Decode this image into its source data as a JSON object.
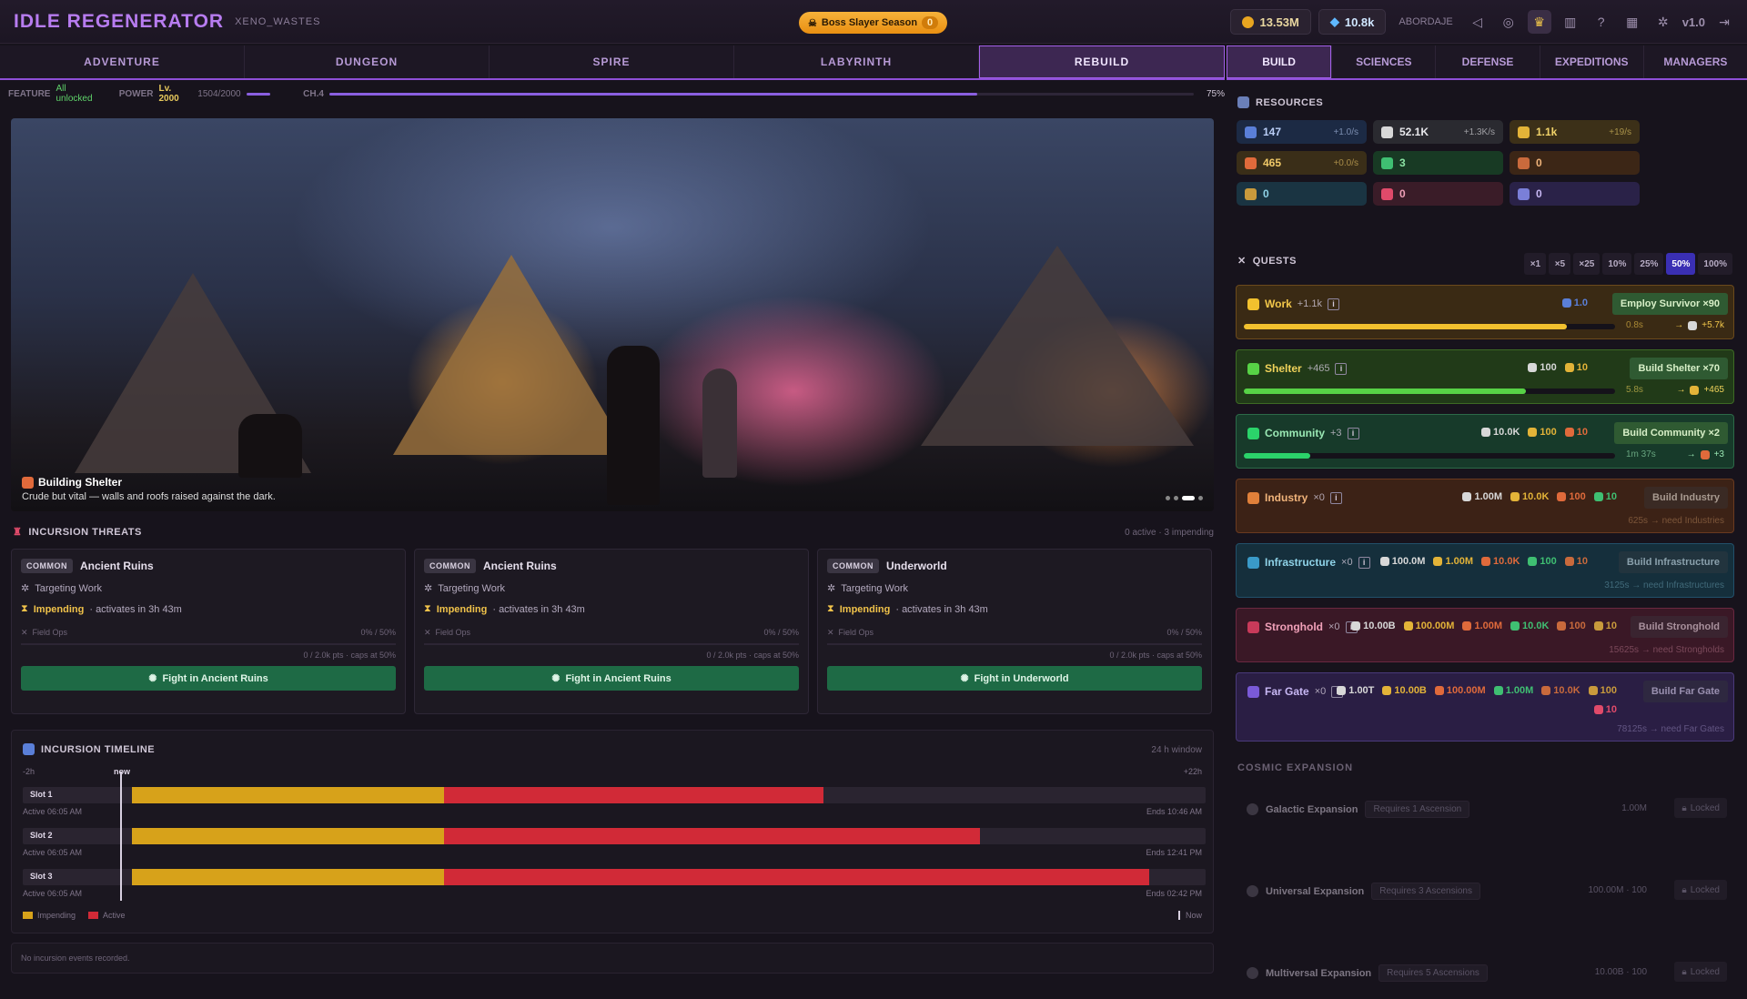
{
  "app": {
    "title": "IDLE REGENERATOR",
    "realm": "XENO_WASTES",
    "version": "v1.0"
  },
  "season": {
    "label": "Boss Slayer Season",
    "count": "0"
  },
  "currencies": {
    "gold": "13.53M",
    "gems": "10.8k",
    "player": "ABORDAJE"
  },
  "nav": {
    "tabs": [
      "ADVENTURE",
      "DUNGEON",
      "SPIRE",
      "LABYRINTH",
      "REBUILD"
    ],
    "active": 4
  },
  "subnav": {
    "tabs": [
      "BUILD",
      "SCIENCES",
      "DEFENSE",
      "EXPEDITIONS",
      "MANAGERS"
    ],
    "active": 0
  },
  "status": {
    "feature_label": "FEATURE",
    "feature_value": "All unlocked",
    "power_label": "POWER",
    "level": "Lv. 2000",
    "power_value": "1504/2000",
    "chapter": "CH.4",
    "chapter_pct": "75%",
    "chapter_progress": 0.75
  },
  "hero": {
    "title": "Building Shelter",
    "desc": "Crude but vital — walls and roofs raised against the dark."
  },
  "threats": {
    "title": "INCURSION THREATS",
    "summary": "0 active · 3 impending",
    "cards": [
      {
        "tag": "COMMON",
        "name": "Ancient Ruins",
        "target": "Targeting Work",
        "status": "Impending",
        "eta": "· activates in 3h 43m",
        "ops": "Field Ops",
        "ops_pct": "0% / 50%",
        "pts": "0 / 2.0k pts · caps at 50%",
        "button": "Fight in Ancient Ruins"
      },
      {
        "tag": "COMMON",
        "name": "Ancient Ruins",
        "target": "Targeting Work",
        "status": "Impending",
        "eta": "· activates in 3h 43m",
        "ops": "Field Ops",
        "ops_pct": "0% / 50%",
        "pts": "0 / 2.0k pts · caps at 50%",
        "button": "Fight in Ancient Ruins"
      },
      {
        "tag": "COMMON",
        "name": "Underworld",
        "target": "Targeting Work",
        "status": "Impending",
        "eta": "· activates in 3h 43m",
        "ops": "Field Ops",
        "ops_pct": "0% / 50%",
        "pts": "0 / 2.0k pts · caps at 50%",
        "button": "Fight in Underworld"
      }
    ]
  },
  "timeline": {
    "title": "INCURSION TIMELINE",
    "window": "24 h window",
    "start": "-2h",
    "now": "now",
    "end": "+22h",
    "slots": [
      {
        "label": "Slot 1",
        "active": "Active 06:05 AM",
        "ends": "Ends 10:46 AM",
        "imp_end": 7,
        "act_end": 15.5
      },
      {
        "label": "Slot 2",
        "active": "Active 06:05 AM",
        "ends": "Ends 12:41 PM",
        "imp_end": 7,
        "act_end": 19
      },
      {
        "label": "Slot 3",
        "active": "Active 06:05 AM",
        "ends": "Ends 02:42 PM",
        "imp_end": 7,
        "act_end": 22.8
      }
    ],
    "legend": {
      "impending": "Impending",
      "active": "Active",
      "now": "Now"
    },
    "empty": "No incursion events recorded."
  },
  "resources": {
    "title": "RESOURCES",
    "items": [
      {
        "value": "147",
        "rate": "+1.0/s",
        "color": "#5a7fd8",
        "bg": "#1c2a44",
        "fg": "#b9cdf6"
      },
      {
        "value": "52.1K",
        "rate": "+1.3K/s",
        "color": "#d8d8d8",
        "bg": "#2a2a30",
        "fg": "#e8e8ec"
      },
      {
        "value": "1.1k",
        "rate": "+19/s",
        "color": "#e3b338",
        "bg": "#3c3018",
        "fg": "#f1d36a"
      },
      {
        "value": "465",
        "rate": "+0.0/s",
        "color": "#e06a3b",
        "bg": "#3a2e18",
        "fg": "#f0c968"
      },
      {
        "value": "3",
        "rate": "",
        "color": "#3fbf72",
        "bg": "#183a24",
        "fg": "#8be3a4"
      },
      {
        "value": "0",
        "rate": "",
        "color": "#c96a3c",
        "bg": "#3c2616",
        "fg": "#f0b37a"
      },
      {
        "value": "0",
        "rate": "",
        "color": "#c99a3c",
        "bg": "#1a3442",
        "fg": "#8fd3e8"
      },
      {
        "value": "0",
        "rate": "",
        "color": "#e04a6a",
        "bg": "#3a1c28",
        "fg": "#f0a0b8"
      },
      {
        "value": "0",
        "rate": "",
        "color": "#7a7fd8",
        "bg": "#2a2248",
        "fg": "#c8b8f4"
      }
    ]
  },
  "quests": {
    "title": "QUESTS",
    "multipliers": [
      "×1",
      "×5",
      "×25",
      "10%",
      "25%",
      "50%",
      "100%"
    ],
    "active_mult": 5,
    "items": [
      {
        "name": "Work",
        "count": "+1.1k",
        "costs": [
          {
            "v": "1.0",
            "c": "#5a7fd8"
          }
        ],
        "button": "Employ Survivor ×90",
        "time": "0.8s",
        "out": "+5.7k",
        "out_c": "#d8d8d8",
        "progress": 0.87,
        "bar": "#f2c12e",
        "bg": "#3a2a14",
        "bd": "#6b4a1c",
        "fg": "#f2c74a",
        "btnbg": "#2f5a32",
        "btnfg": "#d8f0c8"
      },
      {
        "name": "Shelter",
        "count": "+465",
        "costs": [
          {
            "v": "100",
            "c": "#d8d8d8"
          },
          {
            "v": "10",
            "c": "#e3b338"
          }
        ],
        "button": "Build Shelter ×70",
        "time": "5.8s",
        "out": "+465",
        "out_c": "#e3b338",
        "progress": 0.76,
        "bar": "#57d246",
        "bg": "#213a18",
        "bd": "#3d6a24",
        "fg": "#f0d25a",
        "btnbg": "#2f5a32",
        "btnfg": "#d8f0c8"
      },
      {
        "name": "Community",
        "count": "+3",
        "costs": [
          {
            "v": "10.0K",
            "c": "#d8d8d8"
          },
          {
            "v": "100",
            "c": "#e3b338"
          },
          {
            "v": "10",
            "c": "#e06a3b"
          }
        ],
        "button": "Build Community ×2",
        "time": "1m 37s",
        "out": "+3",
        "out_c": "#e06a3b",
        "progress": 0.18,
        "bar": "#2bd36a",
        "bg": "#173a2a",
        "bd": "#2c6a48",
        "fg": "#9ae8b4",
        "btnbg": "#2f5a32",
        "btnfg": "#d8f0c8"
      },
      {
        "name": "Industry",
        "count": "×0",
        "costs": [
          {
            "v": "1.00M",
            "c": "#d8d8d8"
          },
          {
            "v": "10.0K",
            "c": "#e3b338"
          },
          {
            "v": "100",
            "c": "#e06a3b"
          },
          {
            "v": "10",
            "c": "#3fbf72"
          }
        ],
        "button": "Build Industry",
        "time": "",
        "need": "625s → need Industries",
        "progress": 0,
        "bar": "#e0803a",
        "bg": "#3c2216",
        "bd": "#6a3a20",
        "fg": "#f0b37a",
        "btnbg": "#3a2a24",
        "btnfg": "#a89a90"
      },
      {
        "name": "Infrastructure",
        "count": "×0",
        "costs": [
          {
            "v": "100.0M",
            "c": "#d8d8d8"
          },
          {
            "v": "1.00M",
            "c": "#e3b338"
          },
          {
            "v": "10.0K",
            "c": "#e06a3b"
          },
          {
            "v": "100",
            "c": "#3fbf72"
          },
          {
            "v": "10",
            "c": "#c96a3c"
          }
        ],
        "button": "Build Infrastructure",
        "time": "",
        "need": "3125s → need Infrastructures",
        "progress": 0,
        "bar": "#3a9ac8",
        "bg": "#152f3c",
        "bd": "#22506a",
        "fg": "#8fd3e8",
        "btnbg": "#22343e",
        "btnfg": "#8aa0ac"
      },
      {
        "name": "Stronghold",
        "count": "×0",
        "costs": [
          {
            "v": "10.00B",
            "c": "#d8d8d8"
          },
          {
            "v": "100.00M",
            "c": "#e3b338"
          },
          {
            "v": "1.00M",
            "c": "#e06a3b"
          },
          {
            "v": "10.0K",
            "c": "#3fbf72"
          },
          {
            "v": "100",
            "c": "#c96a3c"
          },
          {
            "v": "10",
            "c": "#c99a3c"
          }
        ],
        "button": "Build Stronghold",
        "time": "",
        "need": "15625s → need Strongholds",
        "progress": 0,
        "bar": "#c83a5a",
        "bg": "#3a1826",
        "bd": "#6a2840",
        "fg": "#f0a0b8",
        "btnbg": "#3a2430",
        "btnfg": "#a8909c"
      },
      {
        "name": "Far Gate",
        "count": "×0",
        "costs": [
          {
            "v": "1.00T",
            "c": "#d8d8d8"
          },
          {
            "v": "10.00B",
            "c": "#e3b338"
          },
          {
            "v": "100.00M",
            "c": "#e06a3b"
          },
          {
            "v": "1.00M",
            "c": "#3fbf72"
          },
          {
            "v": "10.0K",
            "c": "#c96a3c"
          },
          {
            "v": "100",
            "c": "#c99a3c"
          },
          {
            "v": "10",
            "c": "#e04a6a"
          }
        ],
        "button": "Build Far Gate",
        "time": "",
        "need": "78125s → need Far Gates",
        "progress": 0,
        "bar": "#7a5ad8",
        "bg": "#2a1e44",
        "bd": "#4a3a7a",
        "fg": "#c8b8f4",
        "btnbg": "#2e2840",
        "btnfg": "#9a90b0"
      }
    ]
  },
  "cosmic": {
    "title": "COSMIC EXPANSION",
    "items": [
      {
        "name": "Galactic Expansion",
        "req": "Requires 1 Ascension",
        "cost": "1.00M",
        "lock": "Locked"
      },
      {
        "name": "Universal Expansion",
        "req": "Requires 3 Ascensions",
        "cost": "100.00M · 100",
        "lock": "Locked"
      },
      {
        "name": "Multiversal Expansion",
        "req": "Requires 5 Ascensions",
        "cost": "10.00B · 100",
        "lock": "Locked"
      }
    ]
  }
}
